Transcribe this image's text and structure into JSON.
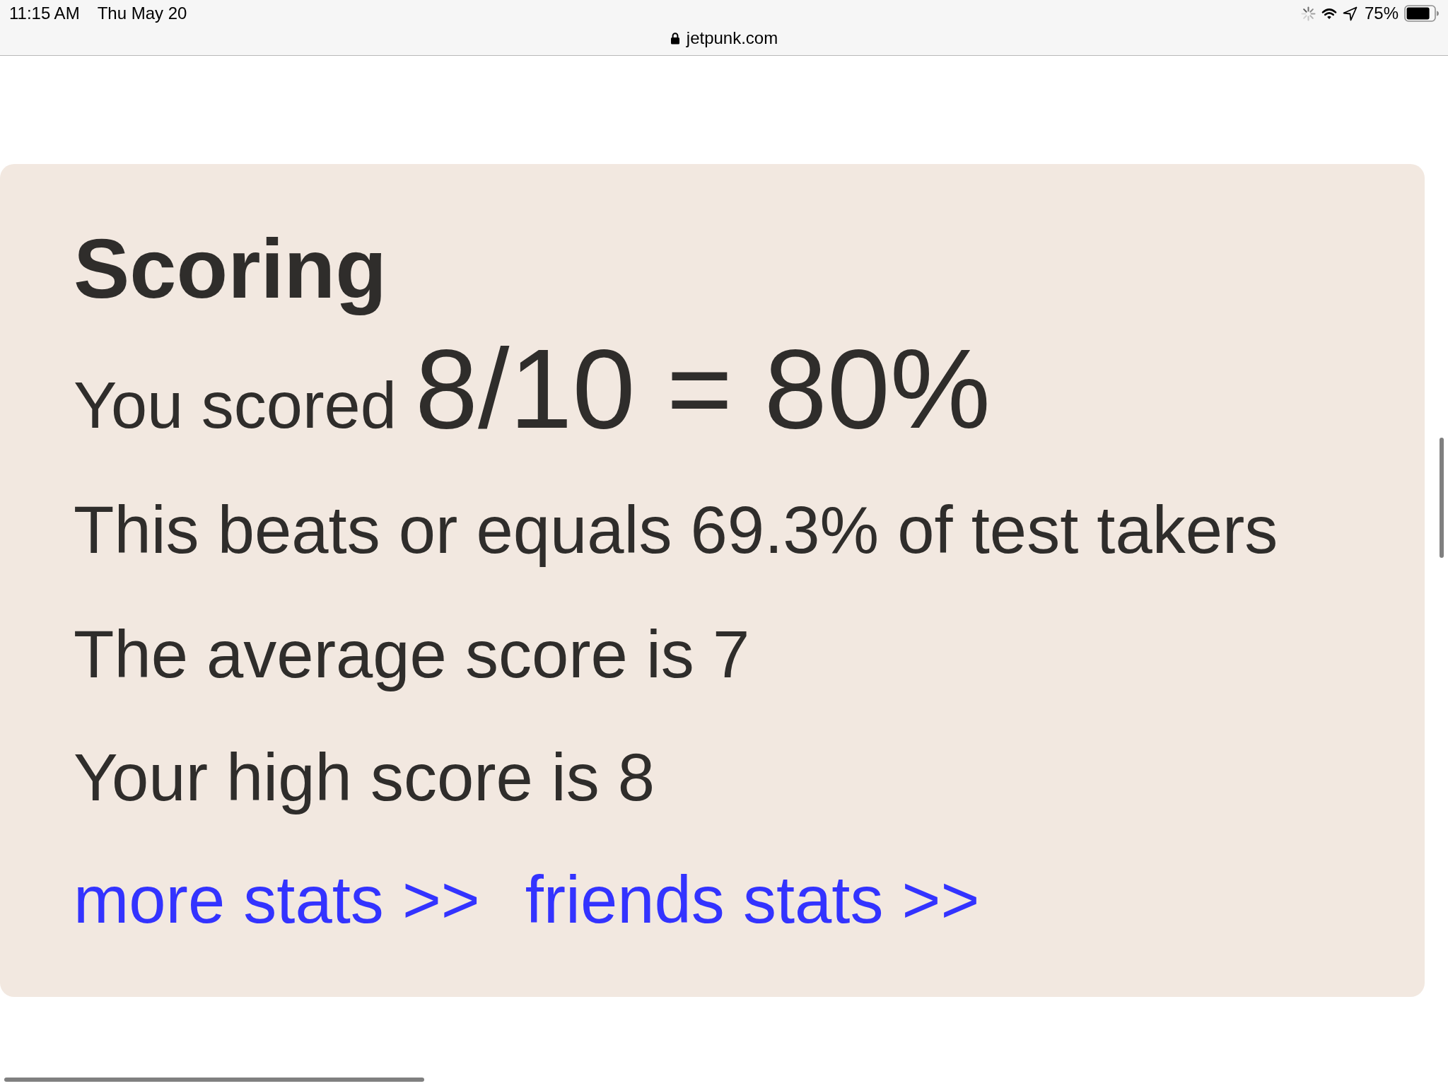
{
  "status_bar": {
    "time": "11:15 AM",
    "date": "Thu May 20",
    "battery_percent": "75%"
  },
  "address_bar": {
    "url": "jetpunk.com"
  },
  "scoring": {
    "title": "Scoring",
    "score_label": "You scored",
    "score": "8/10 = 80%",
    "lines": [
      "This beats or equals 69.3% of test takers",
      "The average score is 7",
      "Your high score is 8"
    ],
    "links": [
      "more stats >>",
      "friends stats >>"
    ]
  }
}
